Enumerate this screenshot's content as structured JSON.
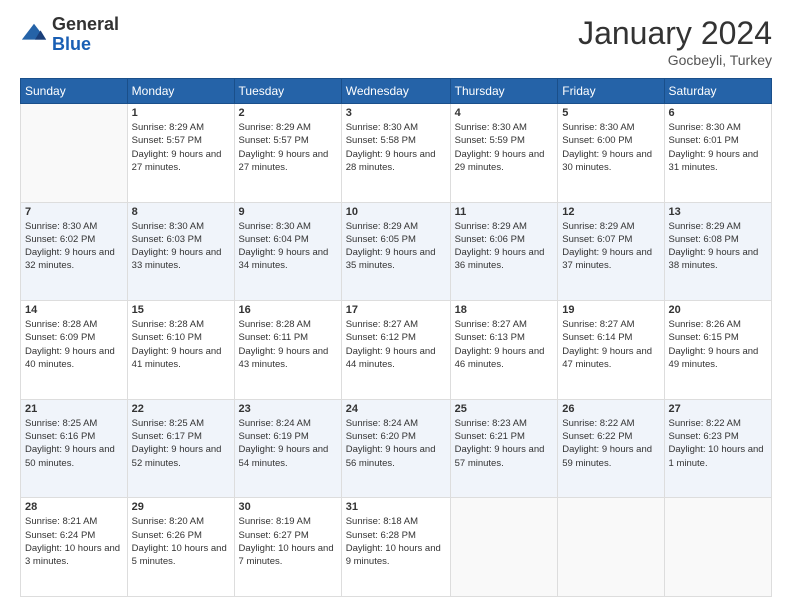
{
  "header": {
    "logo_general": "General",
    "logo_blue": "Blue",
    "month_title": "January 2024",
    "location": "Gocbeyli, Turkey"
  },
  "days_of_week": [
    "Sunday",
    "Monday",
    "Tuesday",
    "Wednesday",
    "Thursday",
    "Friday",
    "Saturday"
  ],
  "weeks": [
    [
      {
        "day": "",
        "sunrise": "",
        "sunset": "",
        "daylight": ""
      },
      {
        "day": "1",
        "sunrise": "8:29 AM",
        "sunset": "5:57 PM",
        "daylight": "9 hours and 27 minutes."
      },
      {
        "day": "2",
        "sunrise": "8:29 AM",
        "sunset": "5:57 PM",
        "daylight": "9 hours and 27 minutes."
      },
      {
        "day": "3",
        "sunrise": "8:30 AM",
        "sunset": "5:58 PM",
        "daylight": "9 hours and 28 minutes."
      },
      {
        "day": "4",
        "sunrise": "8:30 AM",
        "sunset": "5:59 PM",
        "daylight": "9 hours and 29 minutes."
      },
      {
        "day": "5",
        "sunrise": "8:30 AM",
        "sunset": "6:00 PM",
        "daylight": "9 hours and 30 minutes."
      },
      {
        "day": "6",
        "sunrise": "8:30 AM",
        "sunset": "6:01 PM",
        "daylight": "9 hours and 31 minutes."
      }
    ],
    [
      {
        "day": "7",
        "sunrise": "8:30 AM",
        "sunset": "6:02 PM",
        "daylight": "9 hours and 32 minutes."
      },
      {
        "day": "8",
        "sunrise": "8:30 AM",
        "sunset": "6:03 PM",
        "daylight": "9 hours and 33 minutes."
      },
      {
        "day": "9",
        "sunrise": "8:30 AM",
        "sunset": "6:04 PM",
        "daylight": "9 hours and 34 minutes."
      },
      {
        "day": "10",
        "sunrise": "8:29 AM",
        "sunset": "6:05 PM",
        "daylight": "9 hours and 35 minutes."
      },
      {
        "day": "11",
        "sunrise": "8:29 AM",
        "sunset": "6:06 PM",
        "daylight": "9 hours and 36 minutes."
      },
      {
        "day": "12",
        "sunrise": "8:29 AM",
        "sunset": "6:07 PM",
        "daylight": "9 hours and 37 minutes."
      },
      {
        "day": "13",
        "sunrise": "8:29 AM",
        "sunset": "6:08 PM",
        "daylight": "9 hours and 38 minutes."
      }
    ],
    [
      {
        "day": "14",
        "sunrise": "8:28 AM",
        "sunset": "6:09 PM",
        "daylight": "9 hours and 40 minutes."
      },
      {
        "day": "15",
        "sunrise": "8:28 AM",
        "sunset": "6:10 PM",
        "daylight": "9 hours and 41 minutes."
      },
      {
        "day": "16",
        "sunrise": "8:28 AM",
        "sunset": "6:11 PM",
        "daylight": "9 hours and 43 minutes."
      },
      {
        "day": "17",
        "sunrise": "8:27 AM",
        "sunset": "6:12 PM",
        "daylight": "9 hours and 44 minutes."
      },
      {
        "day": "18",
        "sunrise": "8:27 AM",
        "sunset": "6:13 PM",
        "daylight": "9 hours and 46 minutes."
      },
      {
        "day": "19",
        "sunrise": "8:27 AM",
        "sunset": "6:14 PM",
        "daylight": "9 hours and 47 minutes."
      },
      {
        "day": "20",
        "sunrise": "8:26 AM",
        "sunset": "6:15 PM",
        "daylight": "9 hours and 49 minutes."
      }
    ],
    [
      {
        "day": "21",
        "sunrise": "8:25 AM",
        "sunset": "6:16 PM",
        "daylight": "9 hours and 50 minutes."
      },
      {
        "day": "22",
        "sunrise": "8:25 AM",
        "sunset": "6:17 PM",
        "daylight": "9 hours and 52 minutes."
      },
      {
        "day": "23",
        "sunrise": "8:24 AM",
        "sunset": "6:19 PM",
        "daylight": "9 hours and 54 minutes."
      },
      {
        "day": "24",
        "sunrise": "8:24 AM",
        "sunset": "6:20 PM",
        "daylight": "9 hours and 56 minutes."
      },
      {
        "day": "25",
        "sunrise": "8:23 AM",
        "sunset": "6:21 PM",
        "daylight": "9 hours and 57 minutes."
      },
      {
        "day": "26",
        "sunrise": "8:22 AM",
        "sunset": "6:22 PM",
        "daylight": "9 hours and 59 minutes."
      },
      {
        "day": "27",
        "sunrise": "8:22 AM",
        "sunset": "6:23 PM",
        "daylight": "10 hours and 1 minute."
      }
    ],
    [
      {
        "day": "28",
        "sunrise": "8:21 AM",
        "sunset": "6:24 PM",
        "daylight": "10 hours and 3 minutes."
      },
      {
        "day": "29",
        "sunrise": "8:20 AM",
        "sunset": "6:26 PM",
        "daylight": "10 hours and 5 minutes."
      },
      {
        "day": "30",
        "sunrise": "8:19 AM",
        "sunset": "6:27 PM",
        "daylight": "10 hours and 7 minutes."
      },
      {
        "day": "31",
        "sunrise": "8:18 AM",
        "sunset": "6:28 PM",
        "daylight": "10 hours and 9 minutes."
      },
      {
        "day": "",
        "sunrise": "",
        "sunset": "",
        "daylight": ""
      },
      {
        "day": "",
        "sunrise": "",
        "sunset": "",
        "daylight": ""
      },
      {
        "day": "",
        "sunrise": "",
        "sunset": "",
        "daylight": ""
      }
    ]
  ],
  "labels": {
    "sunrise_prefix": "Sunrise: ",
    "sunset_prefix": "Sunset: ",
    "daylight_prefix": "Daylight: "
  }
}
